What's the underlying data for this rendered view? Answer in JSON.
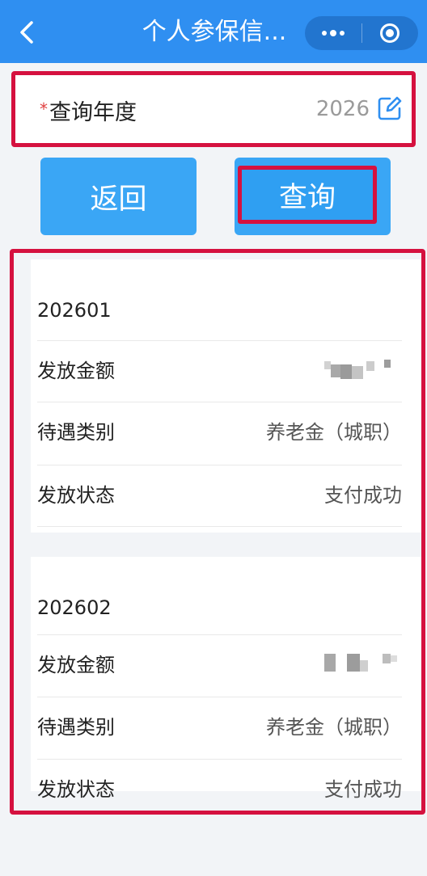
{
  "header": {
    "title": "个人参保信...",
    "back_icon": "chevron-left-icon",
    "more_icon": "more-dots-icon",
    "close_icon": "target-circle-icon",
    "bg_color": "#2f8ff1"
  },
  "query": {
    "required_mark": "*",
    "year_label": "查询年度",
    "year_value": "2026",
    "edit_icon": "edit-icon"
  },
  "buttons": {
    "back_label": "返回",
    "query_label": "查询",
    "color": "#3aa6f5"
  },
  "results": [
    {
      "period": "202601",
      "rows": [
        {
          "label": "发放金额",
          "value": ""
        },
        {
          "label": "待遇类别",
          "value": "养老金（城职）"
        },
        {
          "label": "发放状态",
          "value": "支付成功"
        }
      ]
    },
    {
      "period": "202602",
      "rows": [
        {
          "label": "发放金额",
          "value": ""
        },
        {
          "label": "待遇类别",
          "value": "养老金（城职）"
        },
        {
          "label": "发放状态",
          "value": "支付成功"
        }
      ]
    }
  ],
  "highlight_color": "#d5113f"
}
